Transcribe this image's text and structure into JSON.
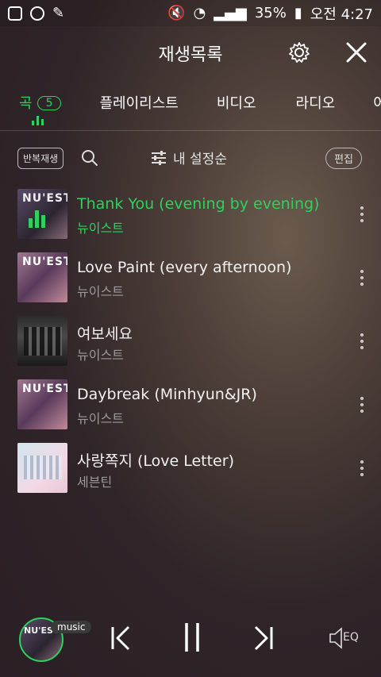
{
  "status_bar": {
    "battery": "35%",
    "time": "오전 4:27"
  },
  "header": {
    "title": "재생목록"
  },
  "tabs": [
    {
      "label": "곡",
      "badge": "5",
      "active": true
    },
    {
      "label": "플레이리스트"
    },
    {
      "label": "비디오"
    },
    {
      "label": "라디오"
    },
    {
      "label": "어"
    }
  ],
  "toolbar": {
    "repeat_label": "반복재생",
    "sort_label": "내 설정순",
    "edit_label": "편집"
  },
  "tracks": [
    {
      "title": "Thank You (evening by evening)",
      "artist": "뉴이스트",
      "playing": true
    },
    {
      "title": "Love Paint (every afternoon)",
      "artist": "뉴이스트"
    },
    {
      "title": "여보세요",
      "artist": "뉴이스트"
    },
    {
      "title": "Daybreak (Minhyun&JR)",
      "artist": "뉴이스트"
    },
    {
      "title": "사랑쪽지 (Love Letter)",
      "artist": "세븐틴"
    }
  ],
  "album_art": {
    "cover_1": "NU'EST",
    "cover_2": "NU'EST",
    "cover_4": "NU'EST",
    "mini_player": "NU'EST"
  },
  "player": {
    "source_tag": "music",
    "eq_label": "EQ"
  },
  "colors": {
    "accent": "#2ed15c"
  }
}
